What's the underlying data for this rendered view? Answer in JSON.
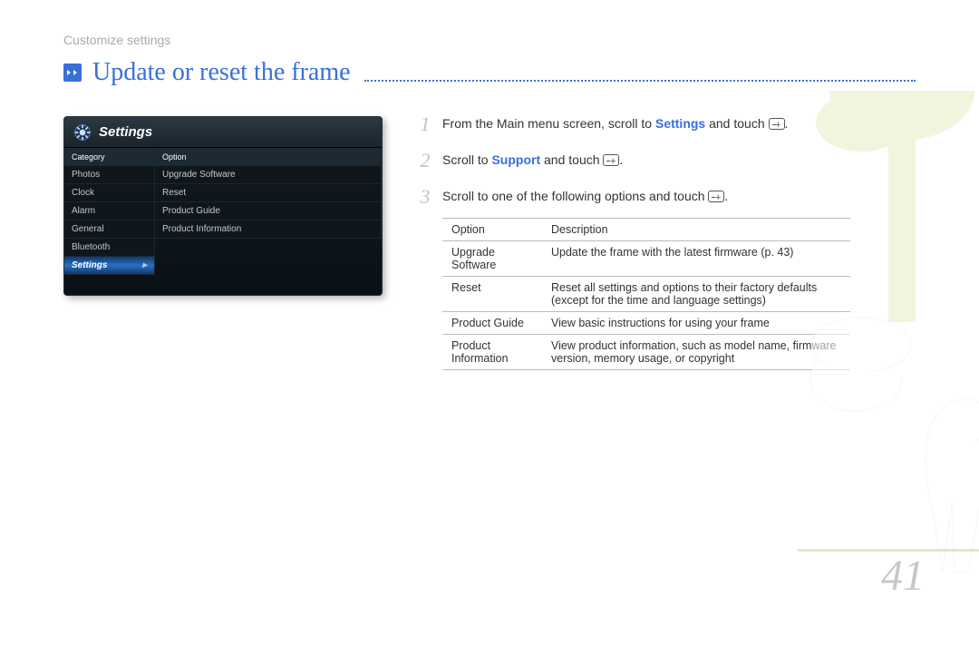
{
  "breadcrumb": "Customize settings",
  "page_title": "Update or reset the frame",
  "page_number": "41",
  "settings_screen": {
    "title": "Settings",
    "left_header": "Category",
    "right_header": "Option",
    "left_items": [
      "Photos",
      "Clock",
      "Alarm",
      "General",
      "Bluetooth",
      "Settings"
    ],
    "right_items": [
      "Upgrade Software",
      "Reset",
      "Product Guide",
      "Product Information"
    ]
  },
  "steps": {
    "s1_a": "From the Main menu screen, scroll to ",
    "s1_hl": "Settings",
    "s1_b": " and touch ",
    "s1_c": ".",
    "s2_a": "Scroll to ",
    "s2_hl": "Support",
    "s2_b": " and touch ",
    "s2_c": ".",
    "s3_a": "Scroll to one of the following options and touch ",
    "s3_b": "."
  },
  "table": {
    "h_option": "Option",
    "h_desc": "Description",
    "rows": [
      {
        "option": "Upgrade Software",
        "desc": "Update the frame with the latest firmware (p. 43)"
      },
      {
        "option": "Reset",
        "desc": "Reset all settings and options to their factory defaults (except for the time and language settings)"
      },
      {
        "option": "Product Guide",
        "desc": "View basic instructions for using your frame"
      },
      {
        "option": "Product Information",
        "desc": "View product information, such as model name, firmware version, memory usage, or copyright"
      }
    ]
  }
}
